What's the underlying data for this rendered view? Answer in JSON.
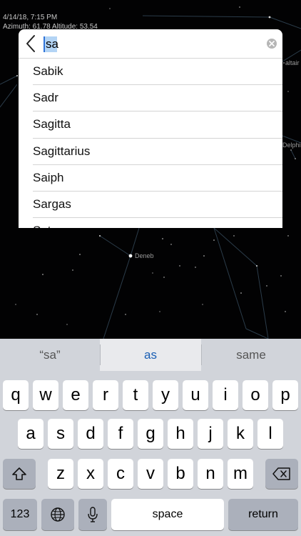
{
  "sky": {
    "info_line_1": "4/14/18, 7:15 PM",
    "info_line_2": "Azimuth: 61.78 Altitude: 53.54",
    "labels": {
      "deneb": "Deneb",
      "edge_right_top": "altair",
      "edge_right_mid": "Delphi"
    }
  },
  "search": {
    "query": "sa",
    "back_icon": "chevron-left-icon",
    "clear_icon": "clear-circle-icon"
  },
  "results": [
    "Sabik",
    "Sadr",
    "Sagitta",
    "Sagittarius",
    "Saiph",
    "Sargas",
    "Saturn"
  ],
  "keyboard": {
    "suggestions": [
      "“sa”",
      "as",
      "same"
    ],
    "row1": [
      "q",
      "w",
      "e",
      "r",
      "t",
      "y",
      "u",
      "i",
      "o",
      "p"
    ],
    "row2": [
      "a",
      "s",
      "d",
      "f",
      "g",
      "h",
      "j",
      "k",
      "l"
    ],
    "row3": [
      "z",
      "x",
      "c",
      "v",
      "b",
      "n",
      "m"
    ],
    "numbers_label": "123",
    "space_label": "space",
    "return_label": "return",
    "icons": {
      "shift": "shift-icon",
      "delete": "delete-icon",
      "globe": "globe-icon",
      "mic": "microphone-icon"
    }
  }
}
